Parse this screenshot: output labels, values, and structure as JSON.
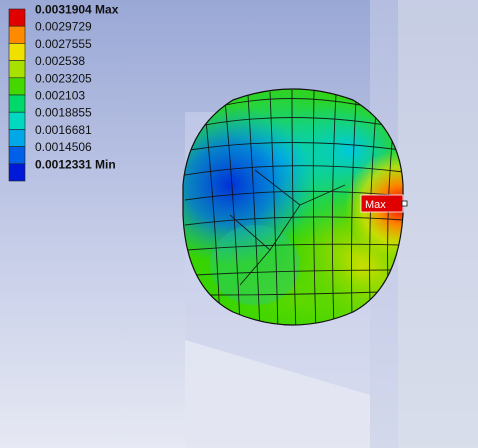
{
  "legend": {
    "entries": [
      {
        "label": "0.0031904 Max",
        "color": "#e00000",
        "bold": true
      },
      {
        "label": "0.0029729",
        "color": "#ff8a00",
        "bold": false
      },
      {
        "label": "0.0027555",
        "color": "#f0e000",
        "bold": false
      },
      {
        "label": "0.002538",
        "color": "#a8e000",
        "bold": false
      },
      {
        "label": "0.0023205",
        "color": "#44d800",
        "bold": false
      },
      {
        "label": "0.002103",
        "color": "#00d86a",
        "bold": false
      },
      {
        "label": "0.0018855",
        "color": "#00d8c0",
        "bold": false
      },
      {
        "label": "0.0016681",
        "color": "#00a8e8",
        "bold": false
      },
      {
        "label": "0.0014506",
        "color": "#0060e8",
        "bold": false
      },
      {
        "label": "0.0012331 Min",
        "color": "#0018d8",
        "bold": true
      }
    ]
  },
  "probe": {
    "max_label": "Max"
  },
  "colors": {
    "background_top": "#9eacd8",
    "background_bottom": "#e2e6f2"
  }
}
